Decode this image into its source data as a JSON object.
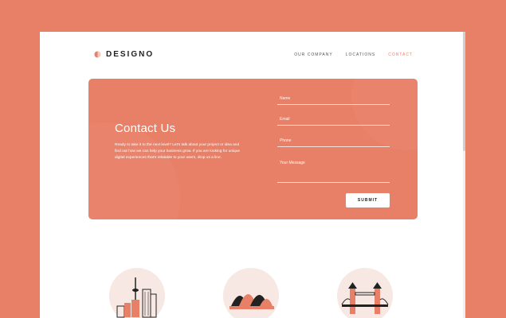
{
  "brand": {
    "name": "DESIGNO",
    "accent_color": "#e88068"
  },
  "nav": {
    "items": [
      {
        "label": "OUR COMPANY",
        "active": false
      },
      {
        "label": "LOCATIONS",
        "active": false
      },
      {
        "label": "CONTACT",
        "active": true
      }
    ]
  },
  "contact": {
    "title": "Contact Us",
    "description": "Ready to take it to the next level? Let's talk about your project or idea and find out how we can help your business grow. If you are looking for unique digital experiences that's relatable to your users, drop us a line.",
    "form": {
      "name_placeholder": "Name",
      "email_placeholder": "Email",
      "phone_placeholder": "Phone",
      "message_placeholder": "Your Message",
      "submit_label": "SUBMIT"
    }
  },
  "locations": [
    {
      "icon": "toronto-skyline-icon"
    },
    {
      "icon": "sydney-opera-house-icon"
    },
    {
      "icon": "tower-bridge-icon"
    }
  ]
}
